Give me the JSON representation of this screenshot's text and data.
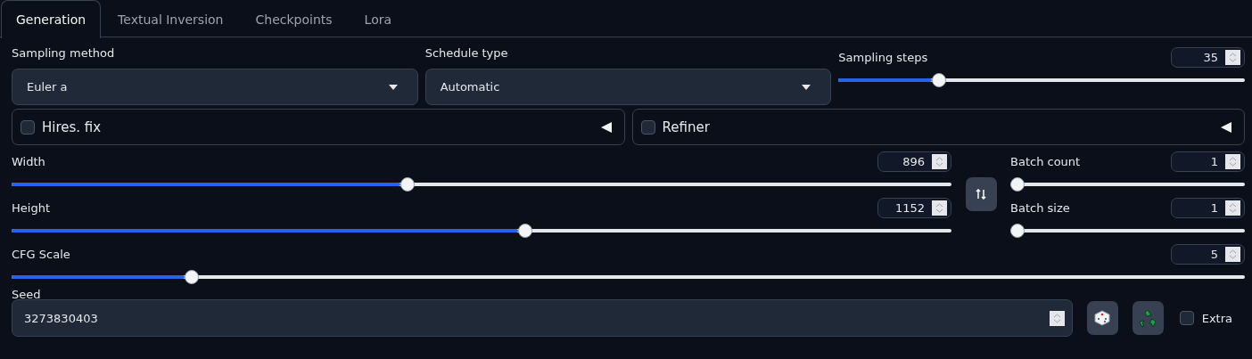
{
  "tabs": [
    {
      "label": "Generation",
      "selected": true
    },
    {
      "label": "Textual Inversion",
      "selected": false
    },
    {
      "label": "Checkpoints",
      "selected": false
    },
    {
      "label": "Lora",
      "selected": false
    }
  ],
  "sampling_method": {
    "label": "Sampling method",
    "value": "Euler a"
  },
  "schedule_type": {
    "label": "Schedule type",
    "value": "Automatic"
  },
  "sampling_steps": {
    "label": "Sampling steps",
    "value": "35",
    "level": 0.237
  },
  "accordions": [
    {
      "label": "Hires. fix",
      "checked": false,
      "expanded": false
    },
    {
      "label": "Refiner",
      "checked": false,
      "expanded": false
    }
  ],
  "width": {
    "label": "Width",
    "value": "896",
    "level": 0.42
  },
  "height": {
    "label": "Height",
    "value": "1152",
    "level": 0.547
  },
  "batch_count": {
    "label": "Batch count",
    "value": "1",
    "level": 0
  },
  "batch_size": {
    "label": "Batch size",
    "value": "1",
    "level": 0
  },
  "cfg_scale": {
    "label": "CFG Scale",
    "value": "5",
    "level": 0.142
  },
  "seed": {
    "label": "Seed",
    "value": "3273830403"
  },
  "extra": {
    "label": "Extra",
    "checked": false
  }
}
